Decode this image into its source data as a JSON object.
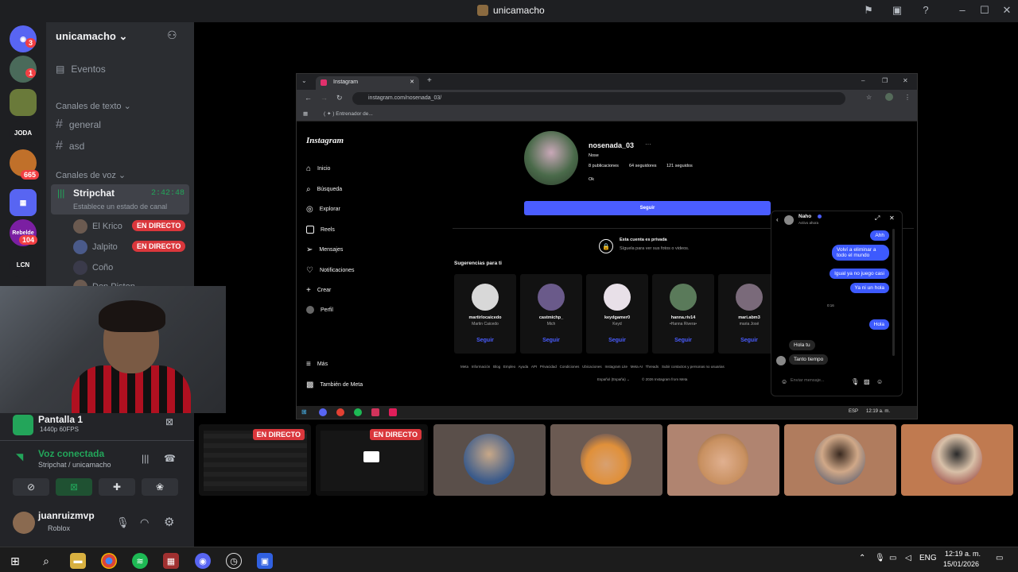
{
  "app_title": "unicamacho",
  "guild": {
    "name": "unicamacho",
    "events_label": "Eventos",
    "text_category": "Canales de texto",
    "text_channels": [
      "general",
      "asd"
    ],
    "voice_category": "Canales de voz",
    "voice_channel": {
      "name": "Stripchat",
      "timer": "2:42:48",
      "status_placeholder": "Establece un estado de canal",
      "users": [
        {
          "name": "El Krico",
          "live": "EN DIRECTO"
        },
        {
          "name": "Jalpito",
          "live": "EN DIRECTO"
        },
        {
          "name": "Coño",
          "live": ""
        },
        {
          "name": "Don Piston",
          "live": ""
        }
      ]
    }
  },
  "servers": {
    "badges": [
      "3",
      "1",
      "665",
      "104"
    ],
    "labels": [
      "JODA",
      "LCN",
      "Rebelde"
    ]
  },
  "stream_panel": {
    "title": "Pantalla 1",
    "quality": "1440p 60FPS",
    "voice_status": "Voz conectada",
    "voice_channel": "Stripchat / unicamacho"
  },
  "user": {
    "name": "juanruizmvp",
    "activity": "Roblox"
  },
  "browser": {
    "tab_title": "Instagram",
    "url": "instagram.com/nosenada_03/",
    "bookmark": "( ✦ ) Entrenador de..."
  },
  "instagram": {
    "logo": "Instagram",
    "nav": [
      "Inicio",
      "Búsqueda",
      "Explorar",
      "Reels",
      "Mensajes",
      "Notificaciones",
      "Crear",
      "Perfil",
      "Más",
      "También de Meta"
    ],
    "profile": {
      "username": "nosenada_03",
      "name": "Nose",
      "stats": [
        "8 publicaciones",
        "64 seguidores",
        "121 seguidos"
      ],
      "bio": "Ok",
      "follow_button": "Seguir"
    },
    "private_title": "Esta cuenta es privada",
    "private_sub": "Síguela para ver sus fotos o videos.",
    "suggestions_title": "Sugerencias para ti",
    "suggestions": [
      {
        "user": "martirlocaicedo",
        "name": "Martin Caicedo",
        "action": "Seguir"
      },
      {
        "user": "castmichp_",
        "name": "Mich",
        "action": "Seguir"
      },
      {
        "user": "keydgamer0",
        "name": "Keyd",
        "action": "Seguir"
      },
      {
        "user": "hanna.riv14",
        "name": "•Hanna Rivera•",
        "action": "Seguir"
      },
      {
        "user": "mari.abm3",
        "name": "maria José",
        "action": "Seguir"
      }
    ],
    "footer_links": [
      "Meta",
      "Información",
      "Blog",
      "Empleo",
      "Ayuda",
      "API",
      "Privacidad",
      "Condiciones",
      "Ubicaciones",
      "Instagram Lite",
      "Meta AI",
      "Threads",
      "Subir contactos y personas no usuarias"
    ],
    "footer_lang": "Español (España) ⌄",
    "footer_copy": "© 2026 Instagram from Meta",
    "dm": {
      "name": "Naho",
      "status": "Activo ahora",
      "messages": [
        {
          "from": "me",
          "text": "Ahh"
        },
        {
          "from": "me",
          "text": "Volví a eliminar a todo el mundo"
        },
        {
          "from": "me",
          "text": "Igual ya no juego casi"
        },
        {
          "from": "me",
          "text": "Ya ni un hola"
        },
        {
          "from": "me",
          "text": "Hola"
        },
        {
          "from": "them",
          "text": "Hola tu"
        },
        {
          "from": "them",
          "text": "Tanto tiempo"
        }
      ],
      "time_sep": "0:16",
      "input_placeholder": "Enviar mensaje..."
    }
  },
  "inner_taskbar": {
    "lang": "ESP",
    "time": "12:19 a. m."
  },
  "stream_tiles": {
    "live_label": "EN DIRECTO"
  },
  "taskbar": {
    "lang": "ENG",
    "time": "12:19 a. m.",
    "date": "15/01/2026"
  },
  "colors": {
    "discord_bg": "#2b2d31",
    "live_red": "#da373c",
    "ig_blue": "#4a5dff",
    "dm_bubble": "#3d5afe"
  }
}
